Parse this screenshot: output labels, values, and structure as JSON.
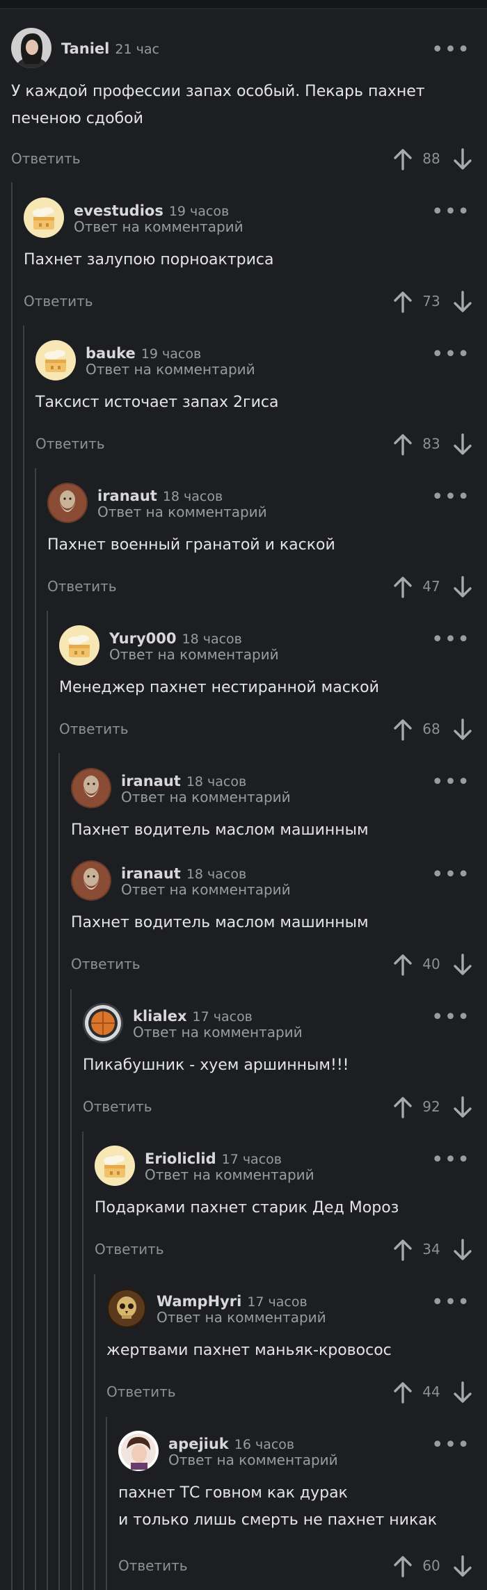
{
  "comments": [
    {
      "author": "Taniel",
      "time": "21 час",
      "reply_note": "",
      "text": "У каждой профессии запах особый. Пекарь пахнет\nпеченою сдобой",
      "reply_label": "Ответить",
      "votes": "88",
      "avatar": "photo-woman"
    },
    {
      "author": "evestudios",
      "time": "19 часов",
      "reply_note": "Ответ на комментарий",
      "text": "Пахнет залупою порноактриса",
      "reply_label": "Ответить",
      "votes": "73",
      "avatar": "default-cake"
    },
    {
      "author": "bauke",
      "time": "19 часов",
      "reply_note": "Ответ на комментарий",
      "text": "Таксист источает запах 2гиса",
      "reply_label": "Ответить",
      "votes": "83",
      "avatar": "default-cake"
    },
    {
      "author": "iranaut",
      "time": "18 часов",
      "reply_note": "Ответ на комментарий",
      "text": "Пахнет военный гранатой и каской",
      "reply_label": "Ответить",
      "votes": "47",
      "avatar": "bearded-man"
    },
    {
      "author": "Yury000",
      "time": "18 часов",
      "reply_note": "Ответ на комментарий",
      "text": "Менеджер пахнет нестиранной маской",
      "reply_label": "Ответить",
      "votes": "68",
      "avatar": "default-cake"
    },
    {
      "author": "iranaut",
      "time": "18 часов",
      "reply_note": "Ответ на комментарий",
      "text": "Пахнет водитель маслом машинным",
      "reply_label": "",
      "votes": "",
      "avatar": "bearded-man"
    },
    {
      "author": "iranaut",
      "time": "18 часов",
      "reply_note": "Ответ на комментарий",
      "text": "Пахнет водитель маслом машинным",
      "reply_label": "Ответить",
      "votes": "40",
      "avatar": "bearded-man"
    },
    {
      "author": "klialex",
      "time": "17 часов",
      "reply_note": "Ответ на комментарий",
      "text": "Пикабушник - хуем аршинным!!!",
      "reply_label": "Ответить",
      "votes": "92",
      "avatar": "round-emblem"
    },
    {
      "author": "Erioliclid",
      "time": "17 часов",
      "reply_note": "Ответ на комментарий",
      "text": "Подарками пахнет старик Дед Мороз",
      "reply_label": "Ответить",
      "votes": "34",
      "avatar": "default-cake"
    },
    {
      "author": "WampHyri",
      "time": "17 часов",
      "reply_note": "Ответ на комментарий",
      "text": "жертвами пахнет маньяк-кровосос",
      "reply_label": "Ответить",
      "votes": "44",
      "avatar": "skull"
    },
    {
      "author": "apejiuk",
      "time": "16 часов",
      "reply_note": "Ответ на комментарий",
      "text": "пахнет ТС говном как дурак\nи только лишь смерть не пахнет никак",
      "reply_label": "Ответить",
      "votes": "60",
      "avatar": "photo-boy"
    }
  ],
  "icons": {
    "more": "more-dots-icon",
    "upvote": "arrow-up-icon",
    "downvote": "arrow-down-icon"
  },
  "colors": {
    "background": "#1d1e21",
    "thread_line": "#3e4045",
    "secondary_text": "#9a9ca0"
  }
}
